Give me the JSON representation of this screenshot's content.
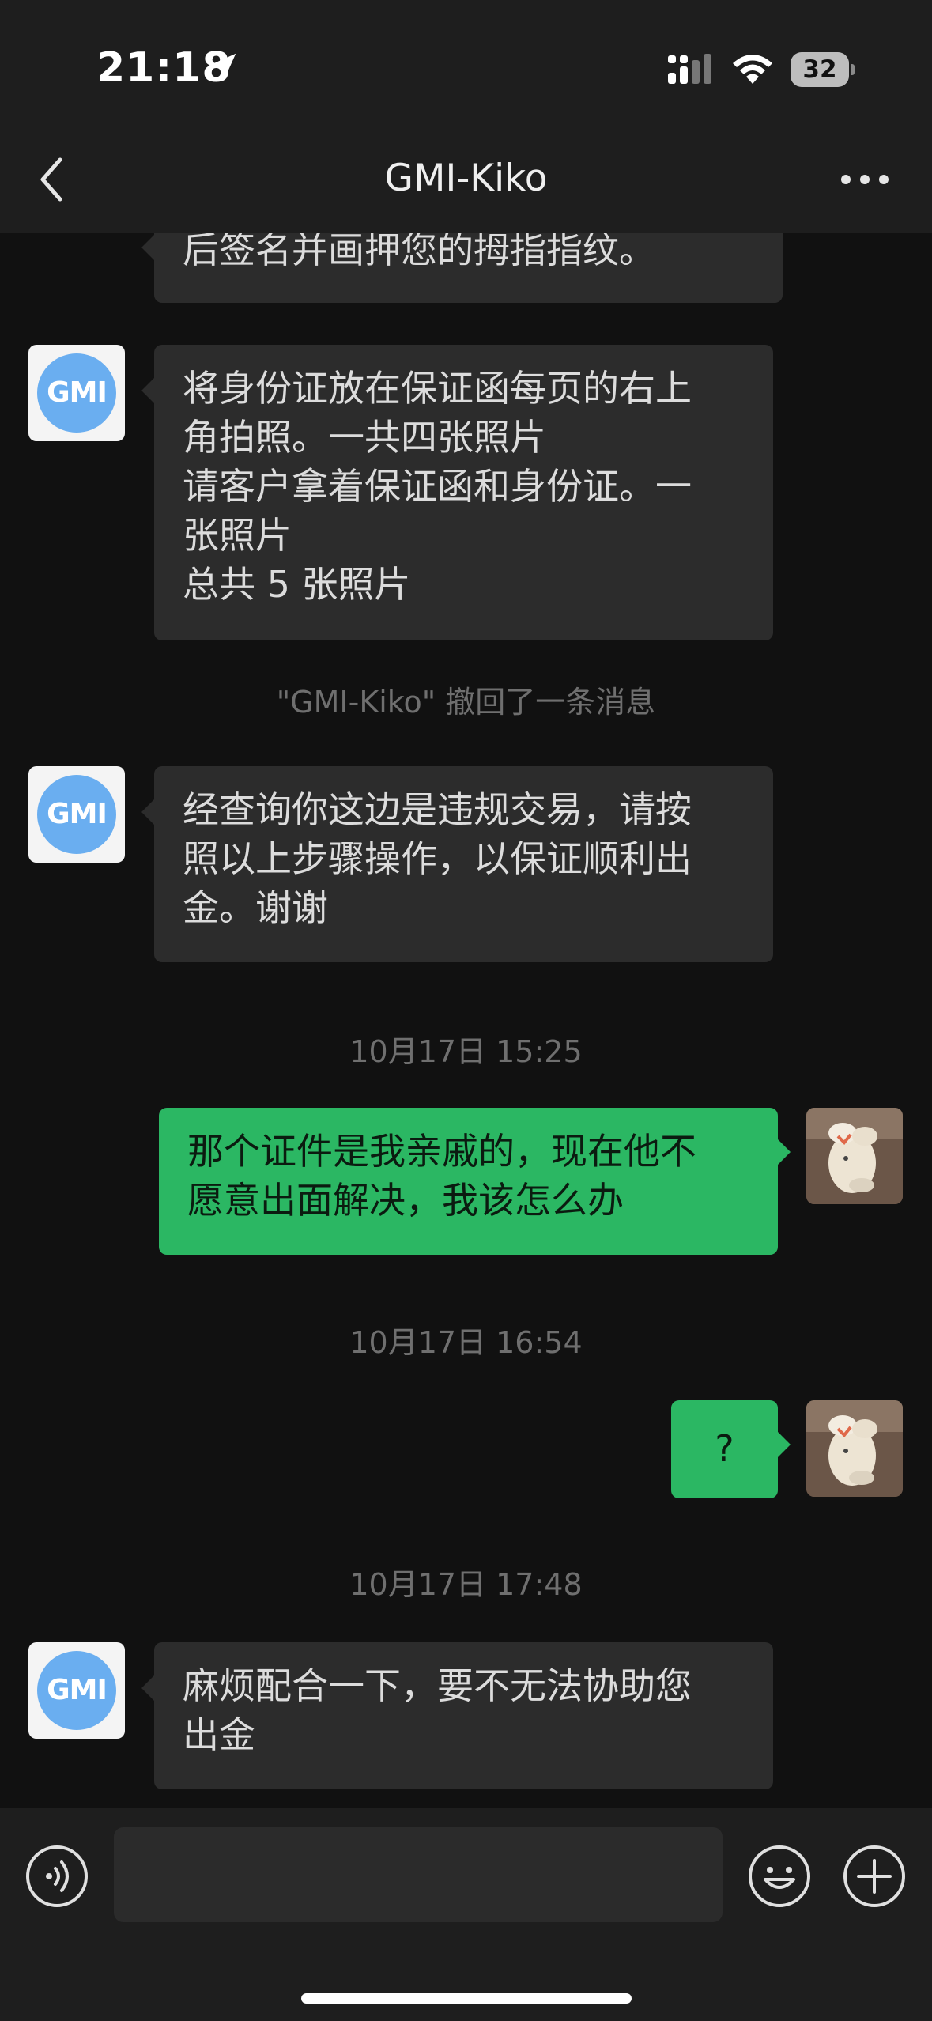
{
  "status_bar": {
    "time": "21:18",
    "battery": "32"
  },
  "nav": {
    "title": "GMI-Kiko"
  },
  "contact_avatar_label": "GMI",
  "messages": [
    {
      "type": "in",
      "lines": [
        "后签名并画押您的拇指指纹。"
      ]
    },
    {
      "type": "in",
      "lines": [
        "将身份证放在保证函每页的右上",
        "角拍照。一共四张照片",
        "请客户拿着保证函和身份证。一",
        "张照片",
        "总共 5 张照片"
      ]
    },
    {
      "type": "system",
      "text": "\"GMI-Kiko\" 撤回了一条消息"
    },
    {
      "type": "in",
      "lines": [
        "经查询你这边是违规交易，请按",
        "照以上步骤操作，以保证顺利出",
        "金。谢谢"
      ]
    },
    {
      "type": "time",
      "text": "10月17日 15:25"
    },
    {
      "type": "out",
      "lines": [
        "那个证件是我亲戚的，现在他不",
        "愿意出面解决，我该怎么办"
      ]
    },
    {
      "type": "time",
      "text": "10月17日 16:54"
    },
    {
      "type": "out",
      "lines": [
        "?"
      ]
    },
    {
      "type": "time",
      "text": "10月17日 17:48"
    },
    {
      "type": "in",
      "lines": [
        "麻烦配合一下，要不无法协助您",
        "出金"
      ]
    }
  ],
  "input": {
    "value": "",
    "placeholder": ""
  },
  "icons": {
    "back": "chevron-left-icon",
    "more": "more-dots-icon",
    "voice": "voice-icon",
    "emoji": "emoji-icon",
    "plus": "plus-icon",
    "location": "location-arrow-icon",
    "signal": "cellular-signal-icon",
    "wifi": "wifi-icon"
  },
  "colors": {
    "background": "#111111",
    "header": "#1e1e1e",
    "incoming_bubble": "#2c2c2c",
    "outgoing_bubble": "#2bb763",
    "avatar_circle": "#6aaef0"
  }
}
